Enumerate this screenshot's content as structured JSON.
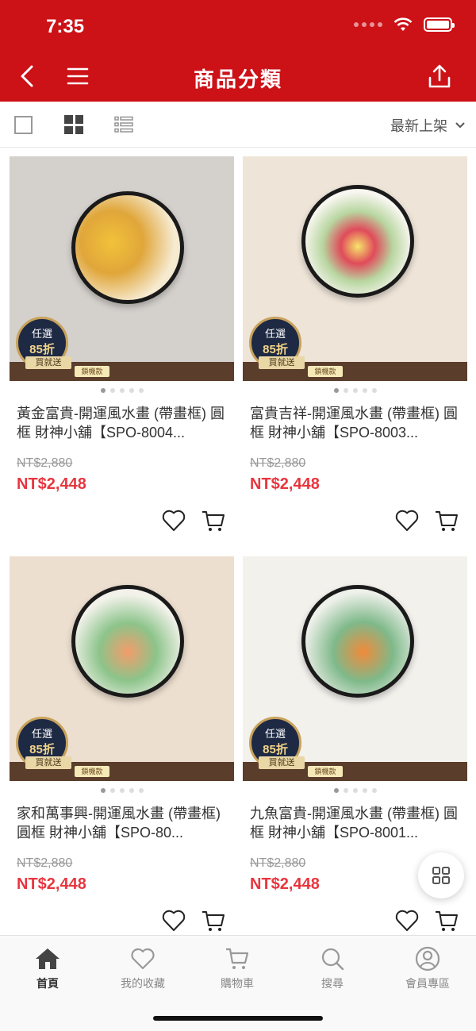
{
  "status_bar": {
    "time": "7:35"
  },
  "header": {
    "title": "商品分類"
  },
  "toolbar": {
    "sort_label": "最新上架"
  },
  "products": [
    {
      "title": "黃金富貴-開運風水畫 (帶畫框) 圓框 財神小舖【SPO-8004...",
      "original_price": "NT$2,880",
      "sale_price": "NT$2,448",
      "badge_top": "任選",
      "badge_discount": "85折",
      "badge_bottom": "買就送",
      "side_badge": "鎖機款"
    },
    {
      "title": "富貴吉祥-開運風水畫 (帶畫框) 圓框 財神小舖【SPO-8003...",
      "original_price": "NT$2,880",
      "sale_price": "NT$2,448",
      "badge_top": "任選",
      "badge_discount": "85折",
      "badge_bottom": "買就送",
      "side_badge": "鎖機款"
    },
    {
      "title": "家和萬事興-開運風水畫 (帶畫框) 圓框 財神小舖【SPO-80...",
      "original_price": "NT$2,880",
      "sale_price": "NT$2,448",
      "badge_top": "任選",
      "badge_discount": "85折",
      "badge_bottom": "買就送",
      "side_badge": "鎖機款"
    },
    {
      "title": "九魚富貴-開運風水畫 (帶畫框) 圓框 財神小舖【SPO-8001...",
      "original_price": "NT$2,880",
      "sale_price": "NT$2,448",
      "badge_top": "任選",
      "badge_discount": "85折",
      "badge_bottom": "買就送",
      "side_badge": "鎖機款"
    }
  ],
  "tab_bar": {
    "items": [
      {
        "label": "首頁",
        "icon": "home-icon",
        "active": true
      },
      {
        "label": "我的收藏",
        "icon": "heart-icon"
      },
      {
        "label": "購物車",
        "icon": "cart-icon"
      },
      {
        "label": "搜尋",
        "icon": "search-icon"
      },
      {
        "label": "會員專區",
        "icon": "user-icon"
      }
    ]
  },
  "colors": {
    "brand": "#cc1117",
    "price": "#e8353e"
  }
}
